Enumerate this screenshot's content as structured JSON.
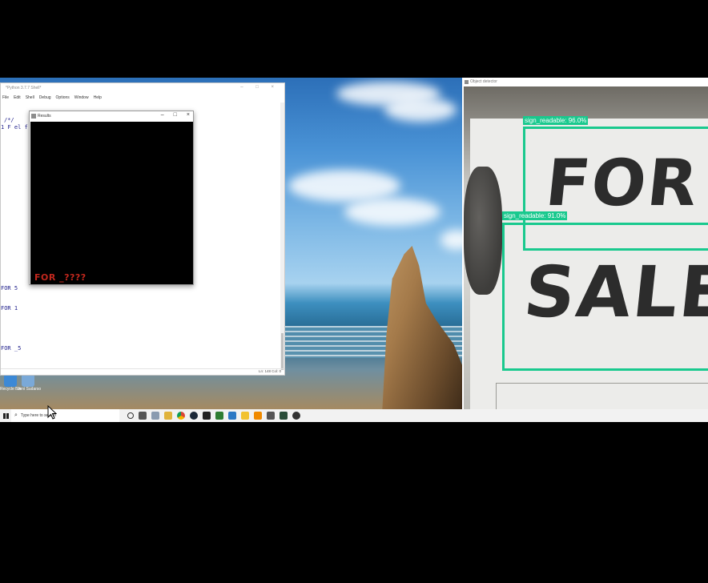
{
  "idle_window": {
    "title": "*Python 3.7.7 Shell*",
    "menu": [
      "File",
      "Edit",
      "Shell",
      "Debug",
      "Options",
      "Window",
      "Help"
    ],
    "code_lines": [
      "/*/",
      "1 F el f",
      "FOR 5",
      "FOR 1",
      "FOR _5"
    ],
    "status": "Ln: 148  Col: 0"
  },
  "results_window": {
    "title": "Results",
    "result_text": "FOR _????"
  },
  "detection_window": {
    "title": "Object detector",
    "sign_line1": "FOR",
    "sign_line2": "SALE",
    "boxes": [
      {
        "label": "sign_readable: 96.0%"
      },
      {
        "label": "sign_readable: 91.0%"
      }
    ],
    "box_color": "#19c98e"
  },
  "desktop": {
    "icons": [
      {
        "label": "Recycle Bin"
      },
      {
        "label": "Jeni Sudarso"
      }
    ]
  },
  "taskbar": {
    "search_placeholder": "Type here to search",
    "pinned_icons": [
      "cortana-icon",
      "task-view-icon",
      "file-explorer-icon",
      "folder-icon",
      "chrome-icon",
      "steam-icon",
      "terminal-icon",
      "app-icon",
      "app-icon-2",
      "python-icon",
      "vlc-icon",
      "app-icon-3",
      "app-icon-4",
      "obs-icon"
    ]
  }
}
